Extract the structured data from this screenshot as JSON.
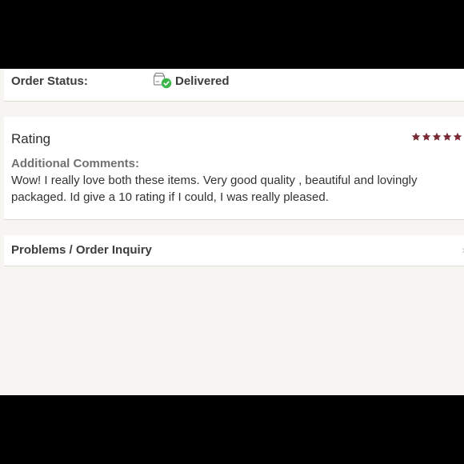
{
  "order_status": {
    "label": "Order Status:",
    "value": "Delivered",
    "icon": "delivered-box-check-icon",
    "check_color": "#3cb54a"
  },
  "rating": {
    "title": "Rating",
    "stars": 5,
    "star_color": "#7a2a35",
    "comments_label": "Additional Comments:",
    "comments_text": "Wow! I really love both these items. Very good quality , beautiful and lovingly packaged. Id give a 10 rating if I could, I was really pleased."
  },
  "problems": {
    "label": "Problems / Order Inquiry",
    "icon": "chevron-right-icon"
  }
}
